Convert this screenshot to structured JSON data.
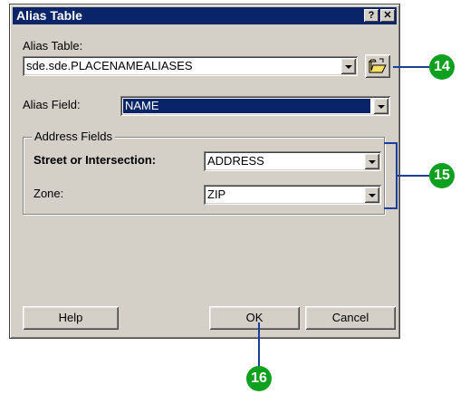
{
  "window": {
    "title": "Alias Table"
  },
  "titlebar": {
    "help_glyph": "?",
    "close_glyph": "✕"
  },
  "alias_table": {
    "label": "Alias Table:",
    "value": "sde.sde.PLACENAMEALIASES"
  },
  "alias_field": {
    "label": "Alias Field:",
    "value": "NAME"
  },
  "address_fields": {
    "legend": "Address Fields",
    "street_label": "Street or Intersection:",
    "street_value": "ADDRESS",
    "zone_label": "Zone:",
    "zone_value": "ZIP"
  },
  "buttons": {
    "help": "Help",
    "ok": "OK",
    "cancel": "Cancel"
  },
  "callouts": {
    "browse": "14",
    "address_fields": "15",
    "ok": "16"
  },
  "colors": {
    "callout": "#10a020",
    "callout_line": "#1a3f9e",
    "selection": "#0a246a"
  }
}
